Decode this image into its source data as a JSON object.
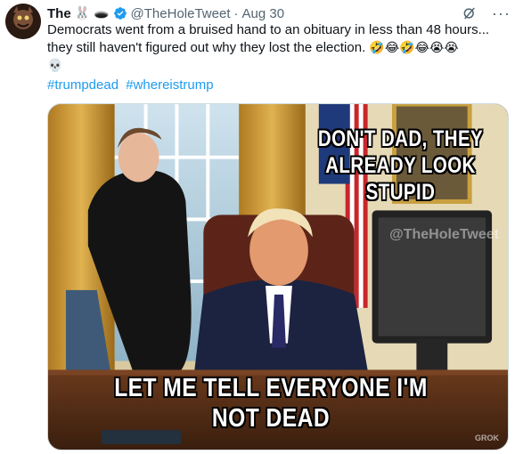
{
  "post": {
    "display_name": "The",
    "name_emojis": [
      "🐰",
      "🕳️"
    ],
    "handle": "@TheHoleTweet",
    "separator": "·",
    "timestamp": "Aug 30",
    "more_label": "···",
    "text_line1": "Democrats went from a bruised hand to an obituary in less than 48 hours...",
    "text_line2": "they still haven't figured out why they lost the election.",
    "text_emojis": "🤣😂🤣😂😭😭",
    "text_line3": "💀",
    "hashtags": [
      "#trumpdead",
      "#whereistrump"
    ]
  },
  "media": {
    "caption_top": "DON'T DAD, THEY ALREADY LOOK STUPID",
    "caption_bottom": "LET ME TELL EVERYONE I'M NOT DEAD",
    "watermark": "@TheHoleTweet",
    "credit": "GROK"
  },
  "colors": {
    "link": "#1d9bf0",
    "verified": "#1d9bf0",
    "secondary_text": "#536471"
  },
  "icons": {
    "verified": "verified-badge-icon",
    "grok": "grok-icon",
    "more": "more-icon"
  }
}
